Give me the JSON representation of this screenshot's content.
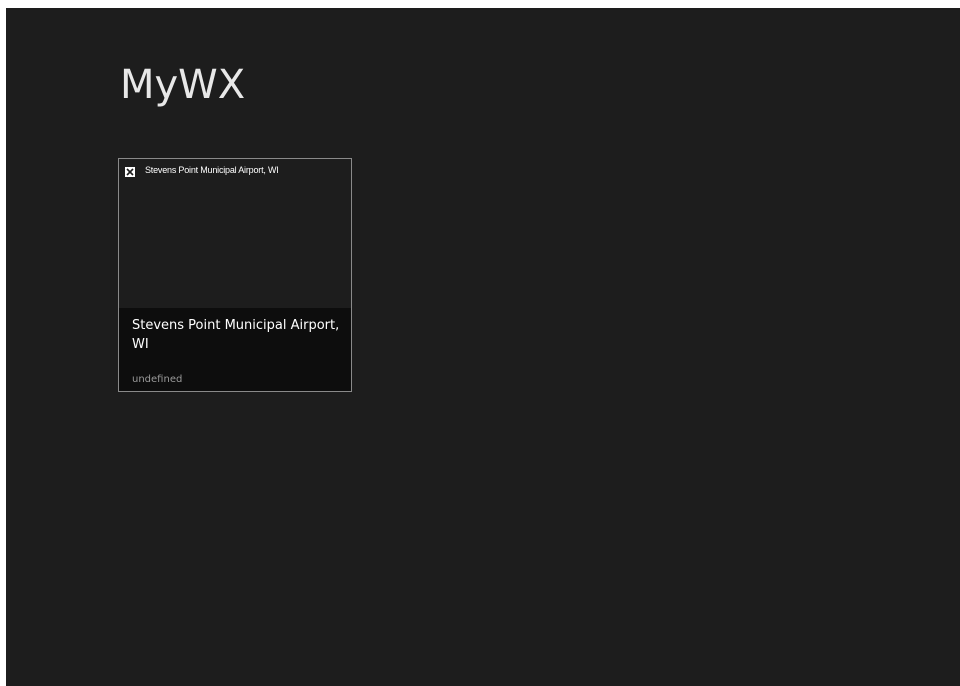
{
  "app": {
    "title": "MyWX"
  },
  "tiles": [
    {
      "image_alt": "Stevens Point Municipal Airport, WI",
      "image_icon": "broken-image-icon",
      "name": "Stevens Point Municipal Airport, WI",
      "subtitle": "undefined"
    }
  ],
  "colors": {
    "background": "#1d1d1d",
    "tile_overlay": "#0d0d0d",
    "tile_border": "#8a8a8a",
    "text_primary": "#ffffff",
    "text_secondary": "#9a9a9a"
  }
}
